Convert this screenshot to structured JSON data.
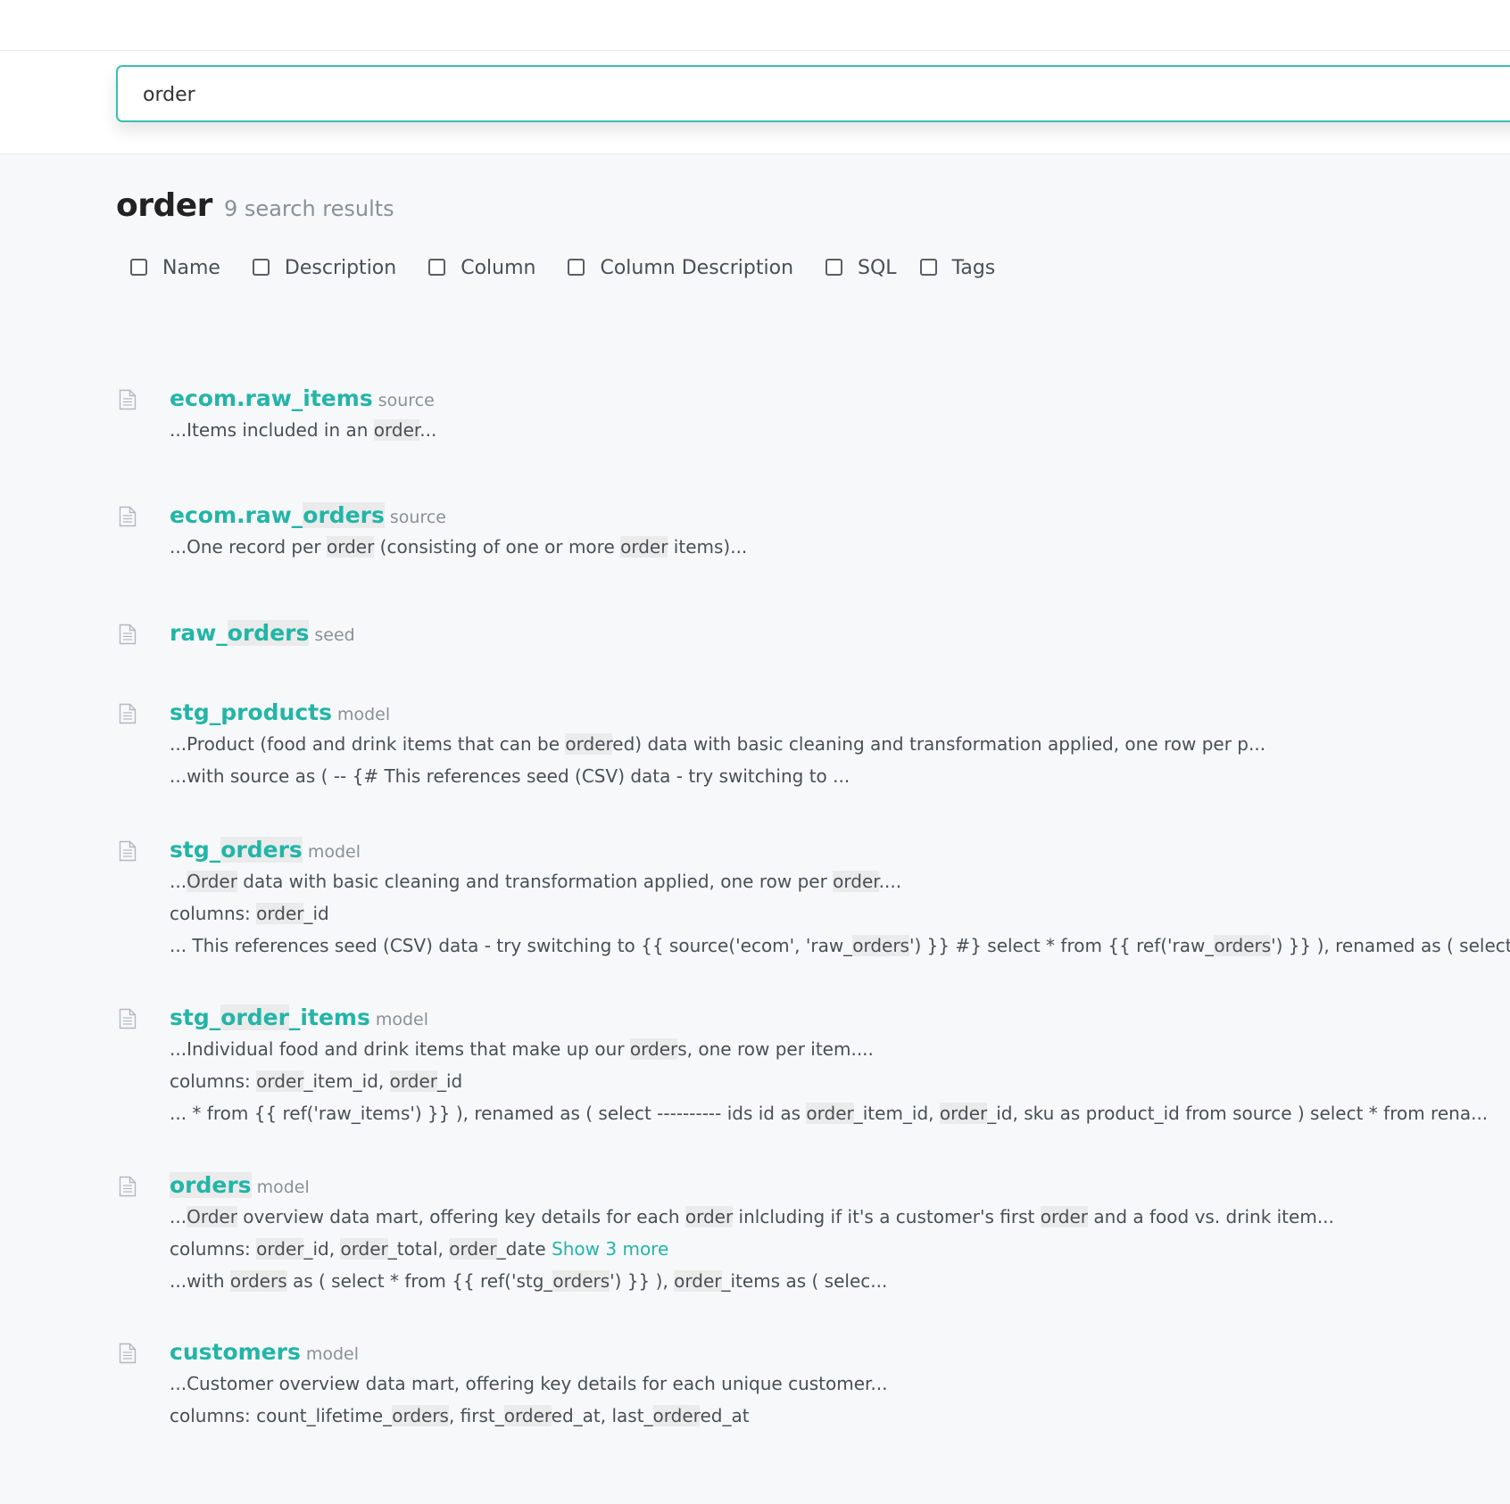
{
  "search": {
    "value": "order"
  },
  "heading": {
    "query": "order",
    "count_text": "9 search results"
  },
  "filters": [
    "Name",
    "Description",
    "Column",
    "Column Description",
    "SQL",
    "Tags"
  ],
  "results": [
    {
      "title": [
        {
          "t": "ecom.raw_items"
        }
      ],
      "type": "source",
      "lines": [
        [
          {
            "t": "...Items included in an "
          },
          {
            "t": "order",
            "h": true
          },
          {
            "t": "..."
          }
        ]
      ]
    },
    {
      "title": [
        {
          "t": "ecom.raw_"
        },
        {
          "t": "orders",
          "h": true
        }
      ],
      "type": "source",
      "lines": [
        [
          {
            "t": "...One record per "
          },
          {
            "t": "order",
            "h": true
          },
          {
            "t": " (consisting of one or more "
          },
          {
            "t": "order",
            "h": true
          },
          {
            "t": " items)..."
          }
        ]
      ]
    },
    {
      "title": [
        {
          "t": "raw_"
        },
        {
          "t": "orders",
          "h": true
        }
      ],
      "type": "seed",
      "lines": []
    },
    {
      "title": [
        {
          "t": "stg_products"
        }
      ],
      "type": "model",
      "lines": [
        [
          {
            "t": "...Product (food and drink items that can be "
          },
          {
            "t": "order",
            "h": true
          },
          {
            "t": "ed) data with basic cleaning and transformation applied, one row per p..."
          }
        ],
        [
          {
            "t": "...with source as ( -- {# This references seed (CSV) data - try switching to ..."
          }
        ]
      ]
    },
    {
      "title": [
        {
          "t": "stg_"
        },
        {
          "t": "orders",
          "h": true
        }
      ],
      "type": "model",
      "lines": [
        [
          {
            "t": "..."
          },
          {
            "t": "Order",
            "h": true
          },
          {
            "t": " data with basic cleaning and transformation applied, one row per "
          },
          {
            "t": "order",
            "h": true
          },
          {
            "t": "...."
          }
        ],
        [
          {
            "t": "columns: "
          },
          {
            "t": "order",
            "h": true
          },
          {
            "t": "_id"
          }
        ],
        [
          {
            "t": "... This references seed (CSV) data - try switching to {{ source('ecom', 'raw_"
          },
          {
            "t": "orders",
            "h": true
          },
          {
            "t": "') }} #} select * from {{ ref('raw_"
          },
          {
            "t": "orders",
            "h": true
          },
          {
            "t": "') }} ), renamed as ( select..."
          }
        ]
      ]
    },
    {
      "title": [
        {
          "t": "stg_"
        },
        {
          "t": "order",
          "h": true
        },
        {
          "t": "_items"
        }
      ],
      "type": "model",
      "lines": [
        [
          {
            "t": "...Individual food and drink items that make up our "
          },
          {
            "t": "order",
            "h": true
          },
          {
            "t": "s, one row per item...."
          }
        ],
        [
          {
            "t": "columns: "
          },
          {
            "t": "order",
            "h": true
          },
          {
            "t": "_item_id, "
          },
          {
            "t": "order",
            "h": true
          },
          {
            "t": "_id"
          }
        ],
        [
          {
            "t": "... * from {{ ref('raw_items') }} ), renamed as ( select ---------- ids id as "
          },
          {
            "t": "order",
            "h": true
          },
          {
            "t": "_item_id, "
          },
          {
            "t": "order",
            "h": true
          },
          {
            "t": "_id, sku as product_id from source ) select * from rena..."
          }
        ]
      ]
    },
    {
      "title": [
        {
          "t": "orders",
          "h": true
        }
      ],
      "type": "model",
      "lines": [
        [
          {
            "t": "..."
          },
          {
            "t": "Order",
            "h": true
          },
          {
            "t": " overview data mart, offering key details for each "
          },
          {
            "t": "order",
            "h": true
          },
          {
            "t": " inlcluding if it's a customer's first "
          },
          {
            "t": "order",
            "h": true
          },
          {
            "t": " and a food vs. drink item..."
          }
        ],
        [
          {
            "t": "columns: "
          },
          {
            "t": "order",
            "h": true
          },
          {
            "t": "_id, "
          },
          {
            "t": "order",
            "h": true
          },
          {
            "t": "_total, "
          },
          {
            "t": "order",
            "h": true
          },
          {
            "t": "_date "
          },
          {
            "t": "Show 3 more",
            "link": true
          }
        ],
        [
          {
            "t": "...with "
          },
          {
            "t": "orders",
            "h": true
          },
          {
            "t": " as ( select * from {{ ref('stg_"
          },
          {
            "t": "orders",
            "h": true
          },
          {
            "t": "') }} ), "
          },
          {
            "t": "order",
            "h": true
          },
          {
            "t": "_items as ( selec..."
          }
        ]
      ]
    },
    {
      "title": [
        {
          "t": "customers"
        }
      ],
      "type": "model",
      "lines": [
        [
          {
            "t": "...Customer overview data mart, offering key details for each unique customer..."
          }
        ],
        [
          {
            "t": "columns: count_lifetime_"
          },
          {
            "t": "orders",
            "h": true
          },
          {
            "t": ", first_"
          },
          {
            "t": "order",
            "h": true
          },
          {
            "t": "ed_at, last_"
          },
          {
            "t": "order",
            "h": true
          },
          {
            "t": "ed_at"
          }
        ]
      ]
    }
  ]
}
